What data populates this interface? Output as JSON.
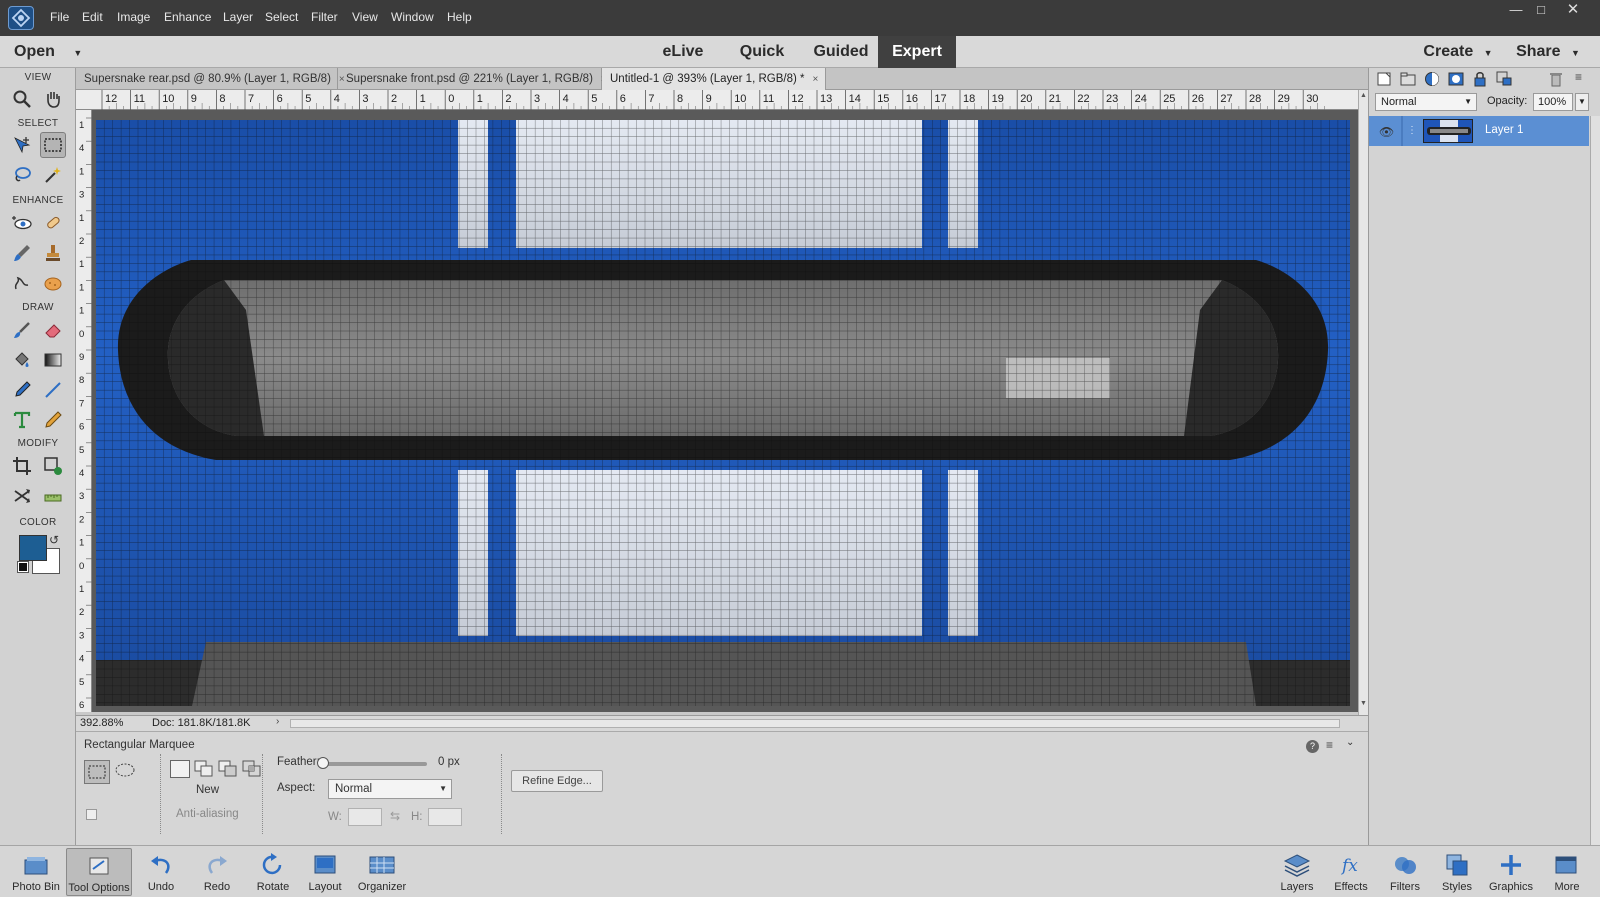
{
  "menubar": {
    "items": [
      "File",
      "Edit",
      "Image",
      "Enhance",
      "Layer",
      "Select",
      "Filter",
      "View",
      "Window",
      "Help"
    ]
  },
  "modes": {
    "open_label": "Open",
    "tabs": [
      "eLive",
      "Quick",
      "Guided",
      "Expert"
    ],
    "active": "Expert",
    "create_label": "Create",
    "share_label": "Share"
  },
  "toolbox": {
    "sections": [
      "VIEW",
      "SELECT",
      "ENHANCE",
      "DRAW",
      "MODIFY",
      "COLOR"
    ],
    "foreground_color": "#1d5e93",
    "background_color": "#ffffff"
  },
  "document_tabs": [
    {
      "label": "Supersnake rear.psd @ 80.9% (Layer 1, RGB/8)",
      "close": "×"
    },
    {
      "label": "Supersnake front.psd @ 221% (Layer 1, RGB/8)",
      "close": "×"
    },
    {
      "label": "Untitled-1 @ 393% (Layer 1, RGB/8) *",
      "close": "×"
    }
  ],
  "active_tab_index": 2,
  "rulers": {
    "horizontal": [
      "12",
      "11",
      "10",
      "9",
      "8",
      "7",
      "6",
      "5",
      "4",
      "3",
      "2",
      "1",
      "0",
      "1",
      "2",
      "3",
      "4",
      "5",
      "6",
      "7",
      "8",
      "9",
      "10",
      "11",
      "12",
      "13",
      "14",
      "15",
      "16",
      "17",
      "18",
      "19",
      "20",
      "21",
      "22",
      "23",
      "24",
      "25",
      "26",
      "27",
      "28",
      "29",
      "30"
    ],
    "vertical": [
      "1",
      "4",
      "1",
      "3",
      "1",
      "2",
      "1",
      "1",
      "1",
      "0",
      "9",
      "8",
      "7",
      "6",
      "5",
      "4",
      "3",
      "2",
      "1",
      "0",
      "1",
      "2",
      "3",
      "4",
      "5",
      "6"
    ]
  },
  "status": {
    "zoom": "392.88%",
    "doc_size": "Doc: 181.8K/181.8K"
  },
  "tool_options": {
    "tool_name": "Rectangular Marquee",
    "mode_label": "New",
    "anti_aliasing_label": "Anti-aliasing",
    "feather_label": "Feather:",
    "feather_value": "0 px",
    "feather_fraction": 0,
    "aspect_label": "Aspect:",
    "aspect_value": "Normal",
    "w_label": "W:",
    "h_label": "H:",
    "refine_edge_label": "Refine Edge..."
  },
  "layers_panel": {
    "blend_mode": "Normal",
    "opacity_label": "Opacity:",
    "opacity_value": "100%",
    "layers": [
      {
        "name": "Layer 1",
        "visible": true
      }
    ],
    "selected_color": "#5b8fd3"
  },
  "bottom_bar": {
    "left": [
      "Photo Bin",
      "Tool Options",
      "Undo",
      "Redo",
      "Rotate",
      "Layout",
      "Organizer"
    ],
    "right": [
      "Layers",
      "Effects",
      "Filters",
      "Styles",
      "Graphics",
      "More"
    ]
  },
  "colors": {
    "car_blue": "#1f55b8",
    "stripe": "#dbe2ee",
    "grille": "#7a7a7a"
  }
}
